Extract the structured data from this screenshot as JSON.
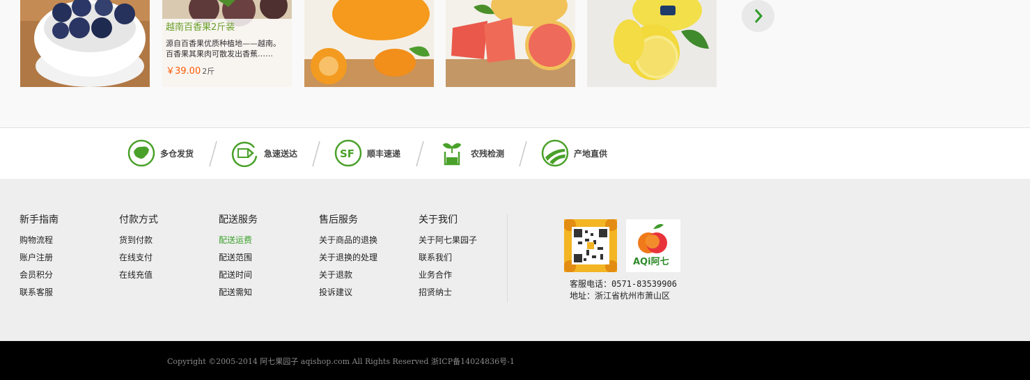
{
  "product_strip": {
    "featured": {
      "name": "越南百香果2斤装",
      "desc_line1": "源自百香果优质种植地——越南。",
      "desc_line2": "百香果其果肉可散发出香蕉……",
      "price": "￥39.00",
      "unit": "2斤"
    },
    "next_icon": "chevron-right-icon"
  },
  "features": [
    {
      "label": "多仓发货",
      "icon": "china-map-icon"
    },
    {
      "label": "急速送达",
      "icon": "fast-delivery-icon"
    },
    {
      "label": "顺丰速递",
      "icon": "sf-express-icon"
    },
    {
      "label": "农残检测",
      "icon": "sprout-test-icon"
    },
    {
      "label": "产地直供",
      "icon": "origin-field-icon"
    }
  ],
  "footer": {
    "columns": [
      {
        "title": "新手指南",
        "links": [
          "购物流程",
          "账户注册",
          "会员积分",
          "联系客服"
        ]
      },
      {
        "title": "付款方式",
        "links": [
          "货到付款",
          "在线支付",
          "在线充值"
        ]
      },
      {
        "title": "配送服务",
        "links": [
          "配送运费",
          "配送范围",
          "配送时间",
          "配送需知"
        ]
      },
      {
        "title": "售后服务",
        "links": [
          "关于商品的退换",
          "关于退换的处理",
          "关于退款",
          "投诉建议"
        ]
      },
      {
        "title": "关于我们",
        "links": [
          "关于阿七果园子",
          "联系我们",
          "业务合作",
          "招贤纳士"
        ]
      }
    ],
    "phone": "客服电话：0571-83539906",
    "address": "地址：浙江省杭州市萧山区",
    "logo_text": "AQi阿七"
  },
  "copyright": "Copyright ©2005-2014 阿七果园子 aqishop.com All Rights Reserved   浙ICP备14024836号-1",
  "colors": {
    "accent_green": "#3aa12b",
    "price_orange": "#ff5a00",
    "footer_bg": "#eeeeee"
  }
}
